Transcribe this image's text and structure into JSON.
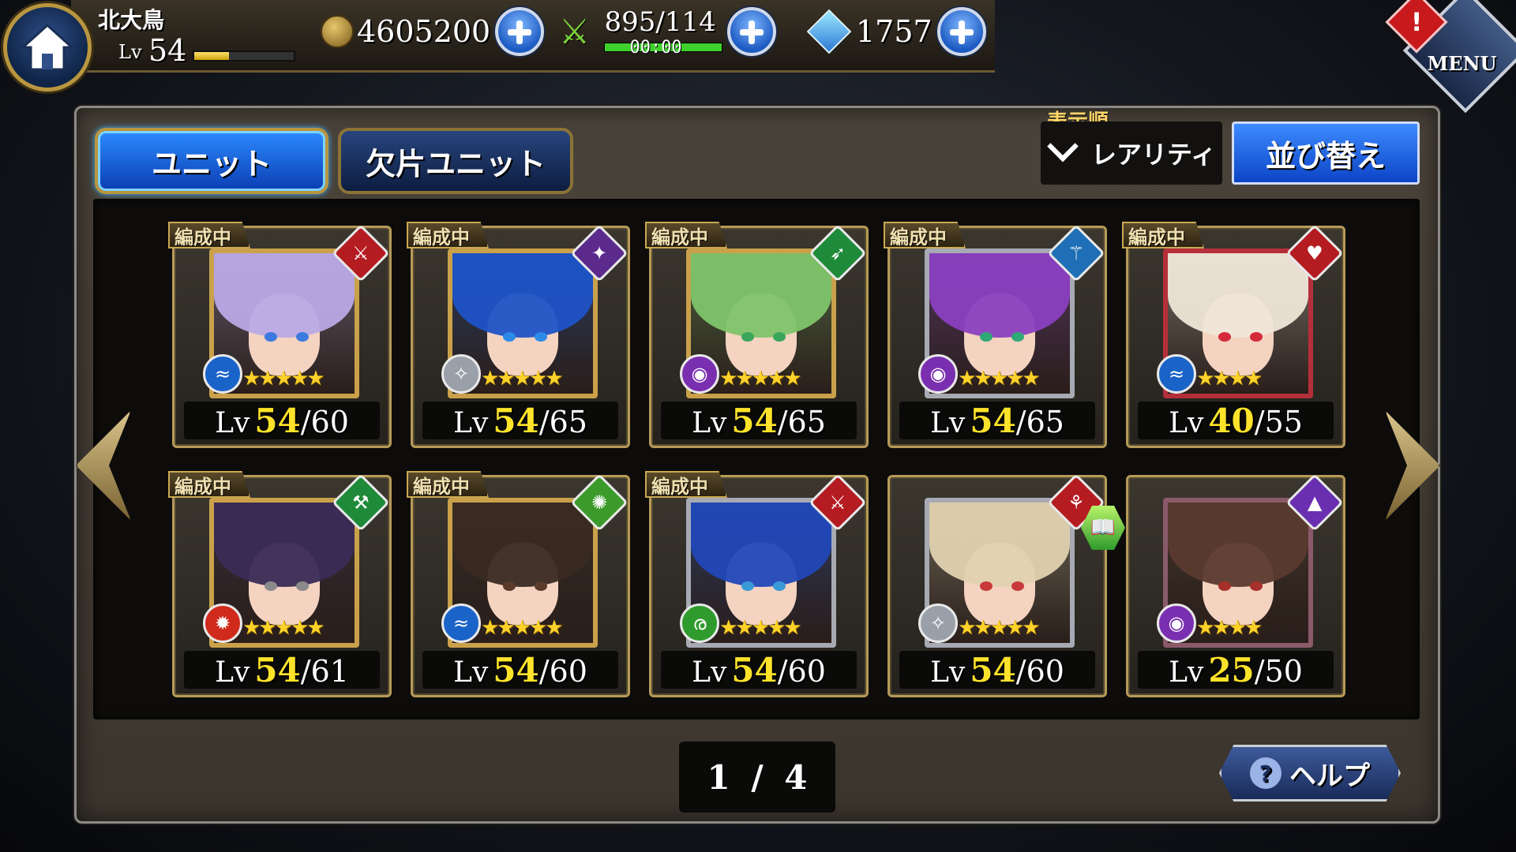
{
  "player": {
    "name": "北大鳥",
    "lv_label": "Lv",
    "level": "54",
    "exp_fraction": 0.35
  },
  "resources": {
    "gold": "4605200",
    "stamina": "895/114",
    "stamina_timer": "00:00",
    "gems": "1757"
  },
  "header": {
    "alert": "!",
    "menu_label": "MENU"
  },
  "tabs": [
    {
      "label": "ユニット",
      "active": true
    },
    {
      "label": "欠片ユニット",
      "active": false
    }
  ],
  "sort": {
    "label": "表示順",
    "value": "レアリティ",
    "button": "並び替え"
  },
  "formation_tag": "編成中",
  "lv_prefix": "Lv",
  "units": [
    {
      "in_formation": true,
      "level": "54",
      "max": "/60",
      "stars": "★★★★★",
      "hair": "#b9a9e6",
      "frame": "#caa14a",
      "class_color": "#b51c22",
      "class_glyph": "⚔",
      "element_color": "#1a63c9",
      "element_glyph": "≈",
      "eye": "#3c7ae0"
    },
    {
      "in_formation": true,
      "level": "54",
      "max": "/65",
      "stars": "★★★★★",
      "hair": "#1d53c6",
      "frame": "#caa14a",
      "class_color": "#5b2a8c",
      "class_glyph": "✦",
      "element_color": "#9aa0aa",
      "element_glyph": "✧",
      "eye": "#2c8ae8"
    },
    {
      "in_formation": true,
      "level": "54",
      "max": "/65",
      "stars": "★★★★★",
      "hair": "#7fc46a",
      "frame": "#caa14a",
      "class_color": "#1f8a3a",
      "class_glyph": "➶",
      "element_color": "#7a2fb0",
      "element_glyph": "◉",
      "eye": "#3aa65a"
    },
    {
      "in_formation": true,
      "level": "54",
      "max": "/65",
      "stars": "★★★★★",
      "hair": "#8a3fc0",
      "frame": "#a7aab3",
      "class_color": "#1e6fb6",
      "class_glyph": "⚚",
      "element_color": "#7a2fb0",
      "element_glyph": "◉",
      "eye": "#2fa878"
    },
    {
      "in_formation": true,
      "level": "40",
      "max": "/55",
      "stars": "★★★★",
      "hair": "#efe6d8",
      "frame": "#b52f3a",
      "class_color": "#b51c22",
      "class_glyph": "♥",
      "element_color": "#1a63c9",
      "element_glyph": "≈",
      "eye": "#d42a3a"
    },
    {
      "in_formation": true,
      "level": "54",
      "max": "/61",
      "stars": "★★★★★",
      "hair": "#3a2b55",
      "frame": "#caa14a",
      "class_color": "#1f8a3a",
      "class_glyph": "⚒",
      "element_color": "#d02a1c",
      "element_glyph": "✹",
      "eye": "#8a8a8a"
    },
    {
      "in_formation": true,
      "level": "54",
      "max": "/60",
      "stars": "★★★★★",
      "hair": "#3a2a22",
      "frame": "#caa14a",
      "class_color": "#3b9a2a",
      "class_glyph": "✺",
      "element_color": "#1a63c9",
      "element_glyph": "≈",
      "eye": "#5a3a2a"
    },
    {
      "in_formation": true,
      "level": "54",
      "max": "/60",
      "stars": "★★★★★",
      "hair": "#2148b8",
      "frame": "#a7aab3",
      "class_color": "#b51c22",
      "class_glyph": "⚔",
      "element_color": "#2f9b2c",
      "element_glyph": "ര",
      "eye": "#3a9ad8"
    },
    {
      "in_formation": false,
      "level": "54",
      "max": "/60",
      "stars": "★★★★★",
      "hair": "#e0d2b0",
      "frame": "#a7aab3",
      "class_color": "#b51c22",
      "class_glyph": "⚘",
      "element_color": "#9aa0aa",
      "element_glyph": "✧",
      "eye": "#c83a3a",
      "book": true
    },
    {
      "in_formation": false,
      "level": "25",
      "max": "/50",
      "stars": "★★★★",
      "hair": "#5a3a2e",
      "frame": "#8a5a6a",
      "class_color": "#6a2fb0",
      "class_glyph": "▲",
      "element_color": "#7a2fb0",
      "element_glyph": "◉",
      "eye": "#a8302a"
    }
  ],
  "pagination": {
    "current": "1",
    "sep": "/",
    "total": "4"
  },
  "help": {
    "icon": "?",
    "label": "ヘルプ"
  }
}
